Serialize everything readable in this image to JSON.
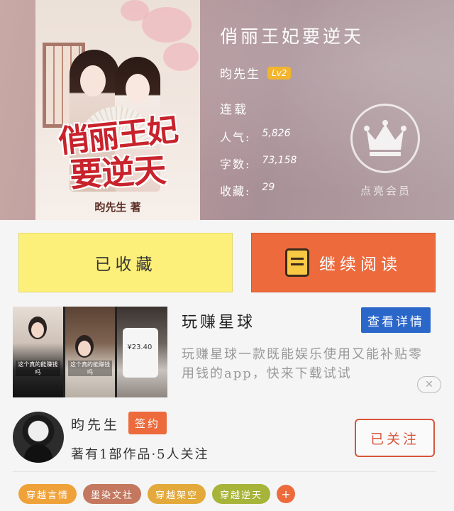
{
  "book": {
    "title": "俏丽王妃要逆天",
    "cover_title_line1": "俏丽王妃",
    "cover_title_line2": "要逆天",
    "cover_author": "昀先生 著",
    "author": "昀先生",
    "author_level": "Lv2",
    "status": "连载",
    "stats": [
      {
        "label": "人气:",
        "value": "5,826"
      },
      {
        "label": "字数:",
        "value": "73,158"
      },
      {
        "label": "收藏:",
        "value": "29"
      }
    ],
    "vip_label": "点亮会员",
    "vip_icon": "crown-icon"
  },
  "actions": {
    "collect_label": "已收藏",
    "read_label": "继续阅读",
    "read_icon": "book-icon"
  },
  "ad": {
    "title": "玩赚星球",
    "button": "查看详情",
    "description": "玩赚星球一款既能娱乐使用又能补贴零用钱的app，快来下载试试",
    "thumb_caption1": "这个真的能赚钱吗",
    "thumb_caption2": "这个真的能赚钱吗",
    "thumb_money": "¥23.40",
    "close_icon": "close-icon"
  },
  "author_card": {
    "name": "昀先生",
    "badge": "签约",
    "summary": "著有1部作品·5人关注",
    "follow_label": "已关注"
  },
  "tags": [
    {
      "label": "穿越言情",
      "color": "#f0a23a"
    },
    {
      "label": "墨染文社",
      "color": "#c4785f"
    },
    {
      "label": "穿越架空",
      "color": "#e3a93a"
    },
    {
      "label": "穿越逆天",
      "color": "#a7b43a"
    }
  ],
  "tags_more": "+",
  "colors": {
    "accent_orange": "#ec6a3b",
    "collect_yellow": "#fdf07a",
    "ad_blue": "#2b67c9"
  }
}
